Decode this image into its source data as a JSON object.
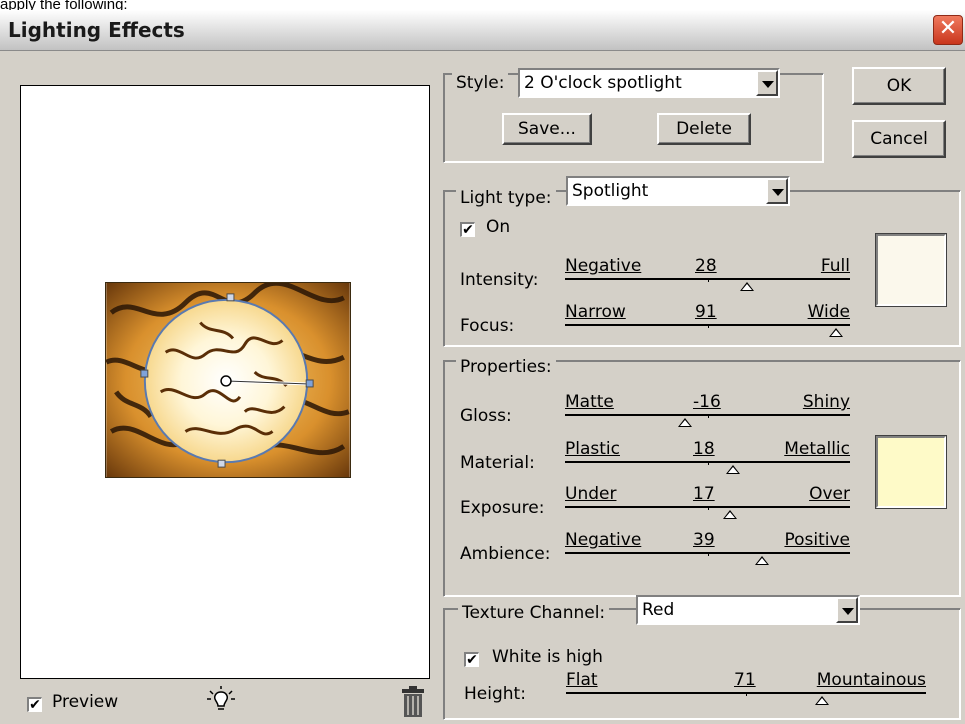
{
  "page_caption": "apply the following:",
  "window": {
    "title": "Lighting Effects",
    "close_glyph": "✕"
  },
  "buttons": {
    "ok": "OK",
    "cancel": "Cancel"
  },
  "style_group": {
    "label": "Style:",
    "selected": "2 O'clock spotlight",
    "save": "Save...",
    "delete": "Delete"
  },
  "light_type_group": {
    "label": "Light type:",
    "selected": "Spotlight",
    "on_label": "On",
    "on_checked": true,
    "color": "#fbf8ec",
    "sliders": [
      {
        "name": "Intensity:",
        "left": "Negative",
        "right": "Full",
        "value": "28",
        "fraction": 0.64
      },
      {
        "name": "Focus:",
        "left": "Narrow",
        "right": "Wide",
        "value": "91",
        "fraction": 0.95
      }
    ]
  },
  "properties_group": {
    "label": "Properties:",
    "color": "#fefac8",
    "sliders": [
      {
        "name": "Gloss:",
        "left": "Matte",
        "right": "Shiny",
        "value": "-16",
        "fraction": 0.42
      },
      {
        "name": "Material:",
        "left": "Plastic",
        "right": "Metallic",
        "value": "18",
        "fraction": 0.59
      },
      {
        "name": "Exposure:",
        "left": "Under",
        "right": "Over",
        "value": "17",
        "fraction": 0.58
      },
      {
        "name": "Ambience:",
        "left": "Negative",
        "right": "Positive",
        "value": "39",
        "fraction": 0.69
      }
    ]
  },
  "texture_group": {
    "label": "Texture Channel:",
    "selected": "Red",
    "white_is_high_label": "White is high",
    "white_is_high_checked": true,
    "slider": {
      "name": "Height:",
      "left": "Flat",
      "right": "Mountainous",
      "value": "71",
      "fraction": 0.71
    }
  },
  "preview": {
    "label": "Preview",
    "checked": true
  }
}
